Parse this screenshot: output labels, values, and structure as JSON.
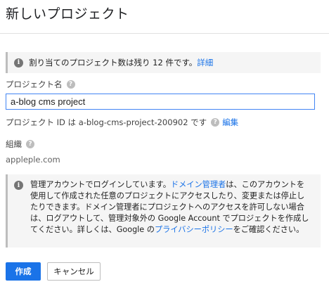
{
  "page": {
    "title": "新しいプロジェクト"
  },
  "quota": {
    "icon": "info-icon",
    "text": "割り当てのプロジェクト数は残り 12 件です。",
    "link": "詳細"
  },
  "project_name": {
    "label": "プロジェクト名",
    "help_icon": "help-icon",
    "value": "a-blog cms project"
  },
  "project_id": {
    "text": "プロジェクト ID は a-blog-cms-project-200902 です",
    "help_icon": "help-icon",
    "edit_link": "編集"
  },
  "organization": {
    "label": "組織",
    "help_icon": "help-icon",
    "value": "appleple.com"
  },
  "notice": {
    "icon": "info-icon",
    "text_1": "管理アカウントでログインしています。",
    "link_1": "ドメイン管理者",
    "text_2": "は、このアカウントを使用して作成された任意のプロジェクトにアクセスしたり、変更または停止したりできます。ドメイン管理者にプロジェクトへのアクセスを許可しない場合は、ログアウトして、管理対象外の Google Account でプロジェクトを作成してください。詳しくは、Google の",
    "link_2": "プライバシーポリシー",
    "text_3": "をご確認ください。"
  },
  "buttons": {
    "create": "作成",
    "cancel": "キャンセル"
  },
  "colors": {
    "accent": "#1a73e8",
    "input_border": "#4285f4",
    "panel_bg": "#f5f5f5"
  }
}
